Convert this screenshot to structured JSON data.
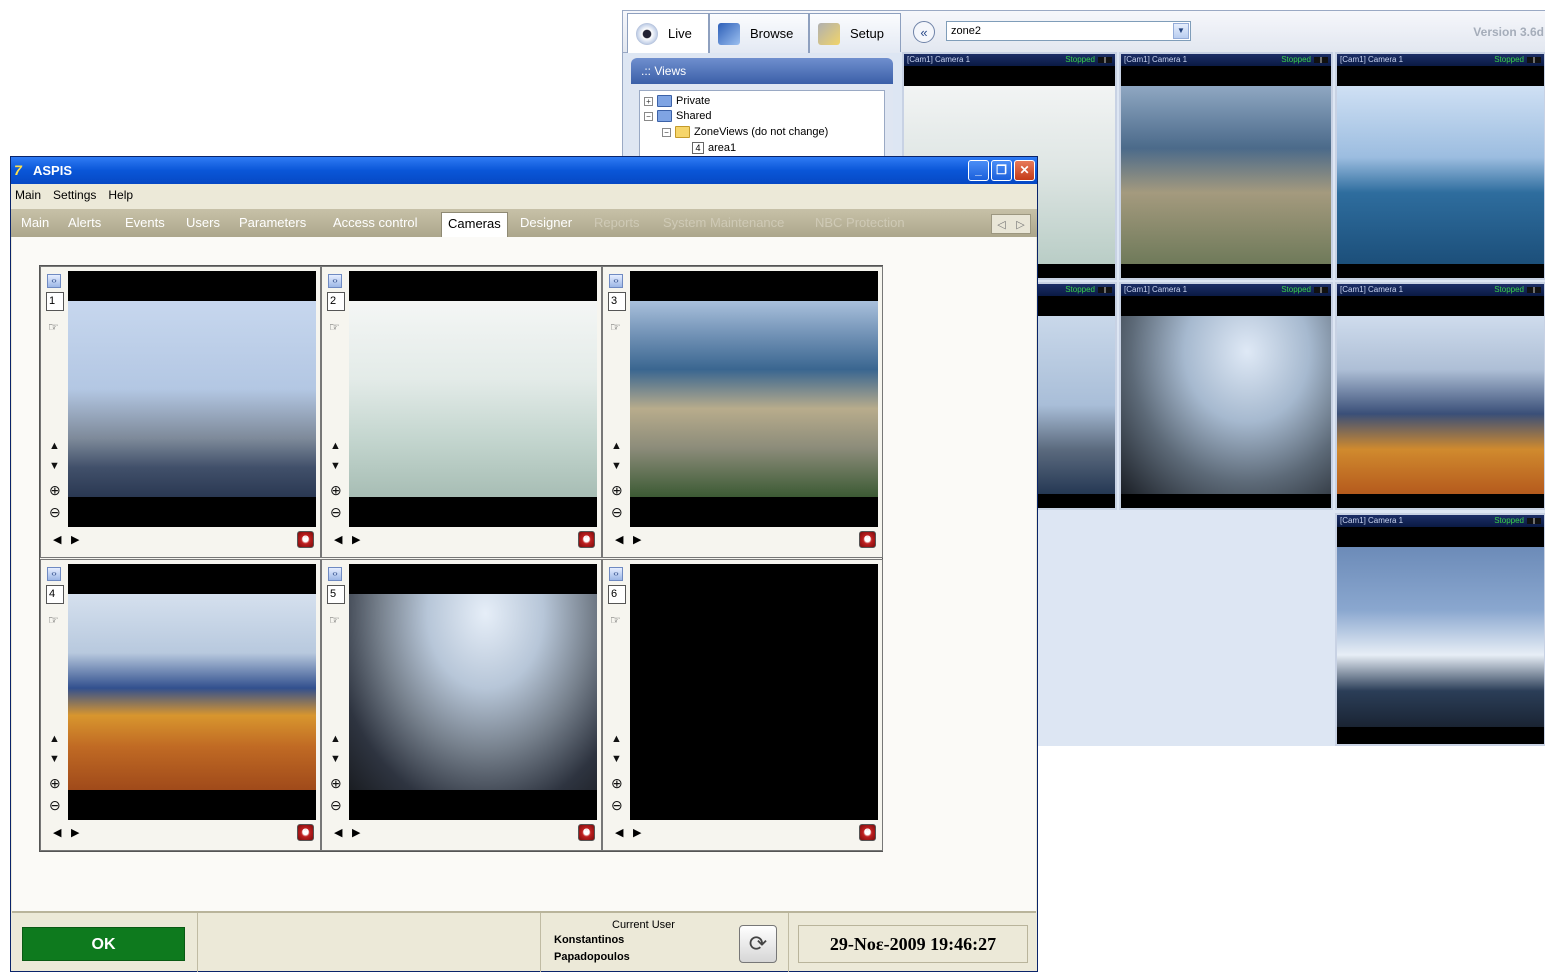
{
  "back_window": {
    "tabs": [
      {
        "label": "Live",
        "icon": "eye-icon"
      },
      {
        "label": "Browse",
        "icon": "browse-icon"
      },
      {
        "label": "Setup",
        "icon": "setup-icon"
      }
    ],
    "zone_value": "zone2",
    "version": "Version 3.6d",
    "views_header": ".:: Views",
    "tree": {
      "private": "Private",
      "shared": "Shared",
      "zoneviews": "ZoneViews (do not change)",
      "area_num": "4",
      "area": "area1"
    },
    "cameras": [
      {
        "label": "[Cam1] Camera 1",
        "status": "Stopped"
      },
      {
        "label": "[Cam1] Camera 1",
        "status": "Stopped"
      },
      {
        "label": "[Cam1] Camera 1",
        "status": "Stopped"
      },
      {
        "label": "",
        "status": "Stopped"
      },
      {
        "label": "[Cam1] Camera 1",
        "status": "Stopped"
      },
      {
        "label": "[Cam1] Camera 1",
        "status": "Stopped"
      },
      {
        "label": "[Cam1] Camera 1",
        "status": "Stopped"
      }
    ]
  },
  "front_window": {
    "title": "ASPIS",
    "menu": [
      "Main",
      "Settings",
      "Help"
    ],
    "tabs": [
      {
        "label": "Main",
        "state": "normal"
      },
      {
        "label": "Alerts",
        "state": "normal"
      },
      {
        "label": "Events",
        "state": "normal"
      },
      {
        "label": "Users",
        "state": "normal"
      },
      {
        "label": "Parameters",
        "state": "normal"
      },
      {
        "label": "Access control",
        "state": "normal"
      },
      {
        "label": "Cameras",
        "state": "active"
      },
      {
        "label": "Designer",
        "state": "normal"
      },
      {
        "label": "Reports",
        "state": "disabled"
      },
      {
        "label": "System Maintenance",
        "state": "disabled"
      },
      {
        "label": "NBC Protection",
        "state": "disabled"
      }
    ],
    "camera_slots": [
      "1",
      "2",
      "3",
      "4",
      "5",
      "6"
    ],
    "ok_label": "OK",
    "current_user_label": "Current User",
    "user_first": "Konstantinos",
    "user_last": "Papadopoulos",
    "datetime": "29-Νοε-2009 19:46:27"
  },
  "colors": {
    "titlebar": "#0a56d8",
    "ok_button": "#0e7a1e",
    "status_running": "#39d24a"
  }
}
